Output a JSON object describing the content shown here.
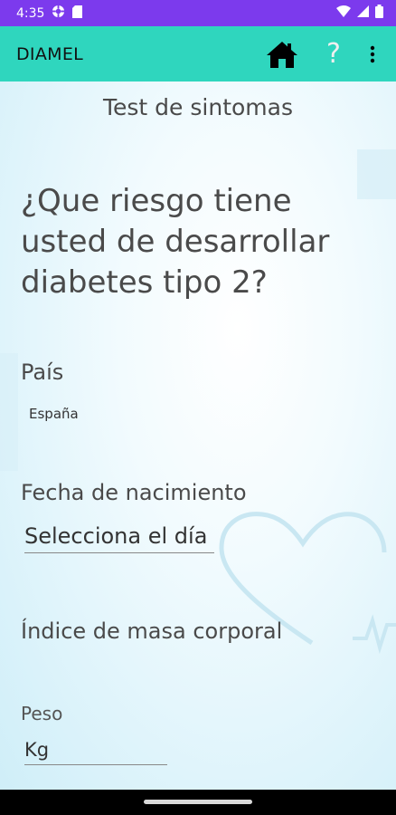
{
  "status_bar": {
    "time": "4:35",
    "icons": [
      "gear-circle-icon",
      "sim-card-icon",
      "wifi-icon",
      "signal-icon",
      "battery-icon"
    ]
  },
  "app_bar": {
    "title": "DIAMEL",
    "home_icon": "home-icon",
    "help_label": "?",
    "more_icon": "more-vertical-icon"
  },
  "main": {
    "subtitle": "Test de sintomas",
    "question": "¿Que riesgo tiene usted de desarrollar diabetes tipo 2?",
    "country_label": "País",
    "country_value": "España",
    "birthdate_label": "Fecha de nacimiento",
    "birthdate_placeholder": "Selecciona el día",
    "bmi_label": "Índice de masa corporal",
    "weight_label": "Peso",
    "weight_placeholder": "Kg"
  },
  "colors": {
    "status_bar": "#7c3aed",
    "app_bar": "#2fd6be",
    "text": "#4a4a4a"
  }
}
